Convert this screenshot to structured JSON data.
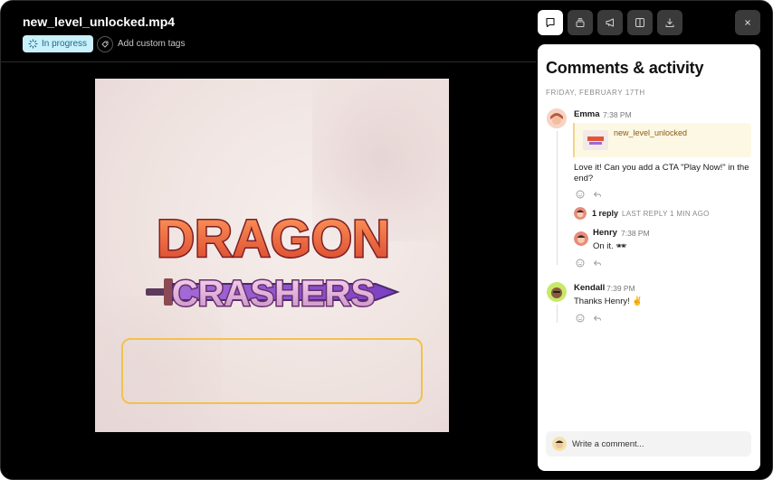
{
  "header": {
    "file_title": "new_level_unlocked.mp4",
    "status": "In progress",
    "add_tags": "Add custom tags"
  },
  "toolbar": {
    "icons": [
      "comment-icon",
      "stack-icon",
      "megaphone-icon",
      "panel-icon",
      "download-icon",
      "close-icon"
    ],
    "active": "comment-icon"
  },
  "media": {
    "logo_line1": "DRAGON",
    "logo_line2": "CRASHERS"
  },
  "panel": {
    "title": "Comments & activity",
    "date": "FRIDAY, FEBRUARY 17TH",
    "comments": [
      {
        "author": "Emma",
        "time": "7:38 PM",
        "attachment": "new_level_unlocked",
        "text_line1": "Love it! Can you add a CTA \"Play Now!\" in the",
        "text_line2": "end?",
        "reply_count": "1 reply",
        "reply_meta": "LAST REPLY 1 MIN AGO",
        "replies": [
          {
            "author": "Henry",
            "time": "7:38 PM",
            "text": "On it. 🕶"
          }
        ]
      },
      {
        "author": "Kendall",
        "time": "7:39 PM",
        "text": "Thanks Henry! ✌"
      }
    ],
    "compose_placeholder": "Write a comment..."
  },
  "colors": {
    "status_bg": "#c9f0fb",
    "status_text": "#1b6b86",
    "highlight": "#f2c14e",
    "attachment_bg": "#fdf8e4"
  }
}
